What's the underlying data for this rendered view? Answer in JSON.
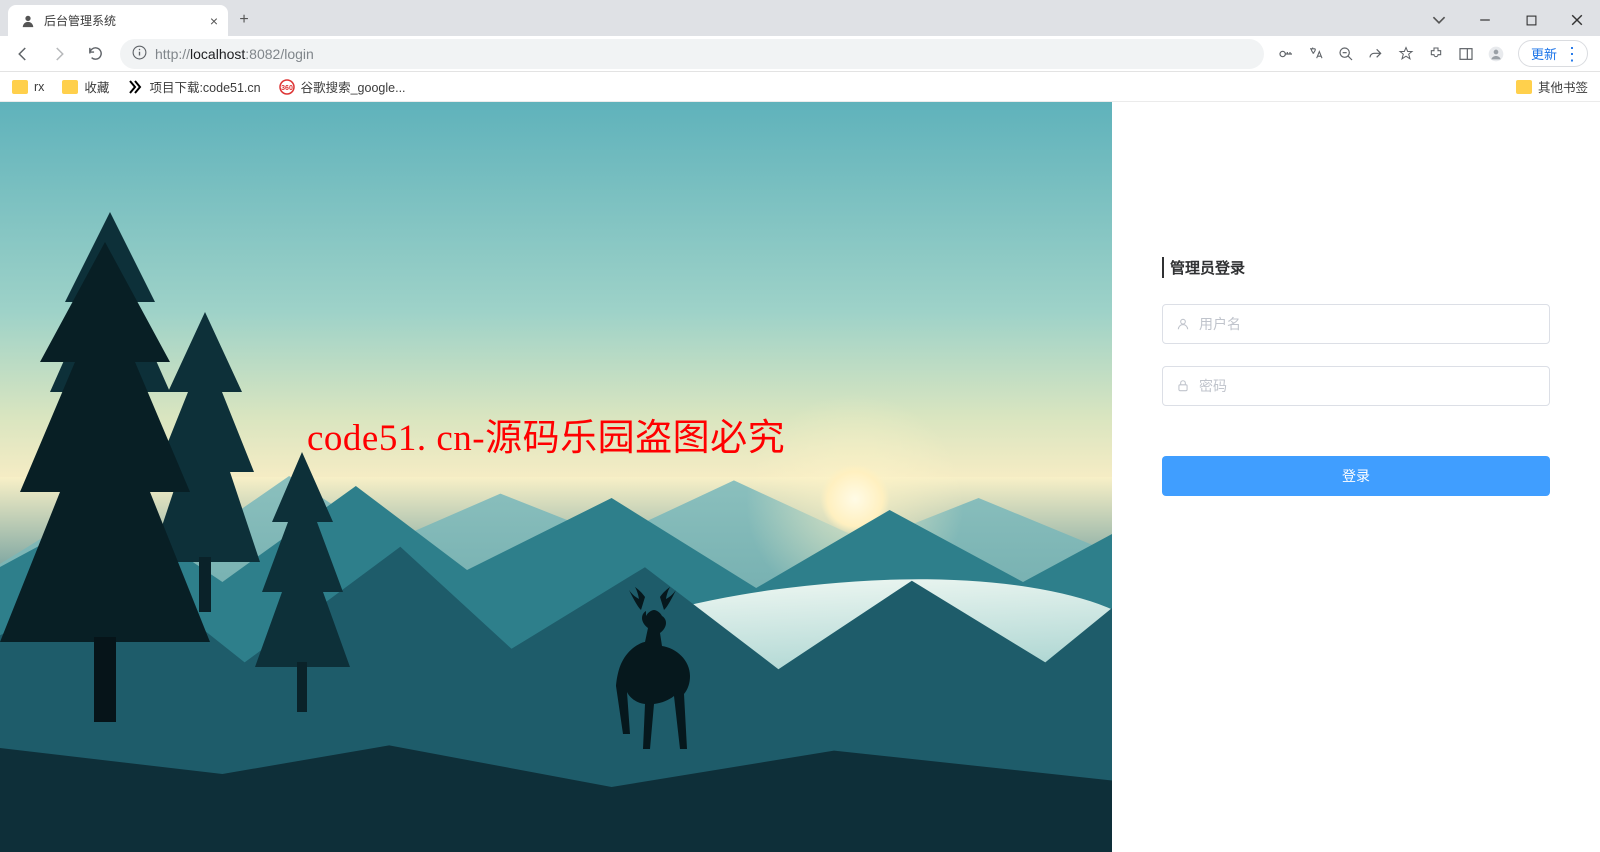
{
  "browser": {
    "tab_title": "后台管理系统",
    "url_prefix": "http://",
    "url_host": "localhost",
    "url_port": ":8082",
    "url_path": "/login",
    "update_label": "更新"
  },
  "bookmarks": {
    "items": [
      "rx",
      "收藏",
      "项目下载:code51.cn",
      "谷歌搜索_google..."
    ],
    "other": "其他书签"
  },
  "watermark": "code51. cn-源码乐园盗图必究",
  "login": {
    "title": "管理员登录",
    "username_placeholder": "用户名",
    "password_placeholder": "密码",
    "submit_label": "登录"
  }
}
